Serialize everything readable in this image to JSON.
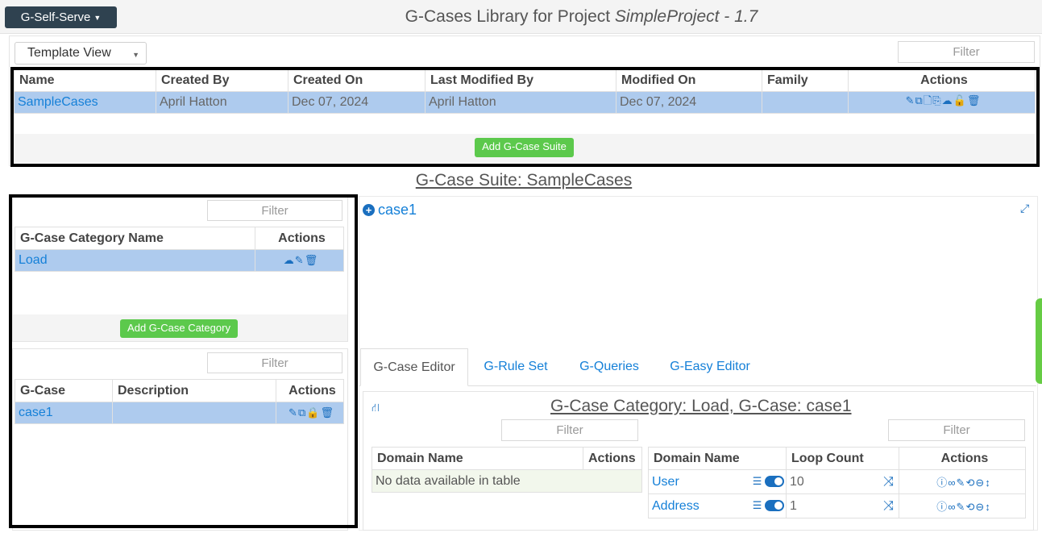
{
  "header": {
    "menu_label": "G-Self-Serve",
    "title_prefix": "G-Cases Library for Project ",
    "project_name": "SimpleProject - 1.7"
  },
  "library": {
    "view_select": "Template View",
    "filter_placeholder": "Filter",
    "columns": [
      "Name",
      "Created By",
      "Created On",
      "Last Modified By",
      "Modified On",
      "Family",
      "Actions"
    ],
    "rows": [
      {
        "name": "SampleCases",
        "created_by": "April Hatton",
        "created_on": "Dec 07, 2024",
        "last_modified_by": "April Hatton",
        "modified_on": "Dec 07, 2024",
        "family": ""
      }
    ],
    "add_button": "Add G-Case Suite"
  },
  "suite": {
    "title": "G-Case Suite: SampleCases"
  },
  "categories": {
    "filter_placeholder": "Filter",
    "columns": [
      "G-Case Category Name",
      "Actions"
    ],
    "rows": [
      {
        "name": "Load"
      }
    ],
    "add_button": "Add G-Case Category"
  },
  "gcases": {
    "filter_placeholder": "Filter",
    "columns": [
      "G-Case",
      "Description",
      "Actions"
    ],
    "rows": [
      {
        "name": "case1",
        "description": ""
      }
    ]
  },
  "tree": {
    "node_label": "case1"
  },
  "tabs": [
    {
      "label": "G-Case Editor",
      "active": true
    },
    {
      "label": "G-Rule Set",
      "active": false
    },
    {
      "label": "G-Queries",
      "active": false
    },
    {
      "label": "G-Easy Editor",
      "active": false
    }
  ],
  "editor": {
    "title": "G-Case Category: Load, G-Case: case1",
    "left_filter": "Filter",
    "right_filter": "Filter",
    "left_columns": [
      "Domain Name",
      "Actions"
    ],
    "left_empty": "No data available in table",
    "right_columns": [
      "Domain Name",
      "Loop Count",
      "Actions"
    ],
    "right_rows": [
      {
        "domain": "User",
        "loop_count": "10"
      },
      {
        "domain": "Address",
        "loop_count": "1"
      }
    ]
  },
  "colors": {
    "accent": "#1a6fbf",
    "selected_row": "#aecbee",
    "green_button": "#5cc94c",
    "menu_button": "#2f4250"
  }
}
